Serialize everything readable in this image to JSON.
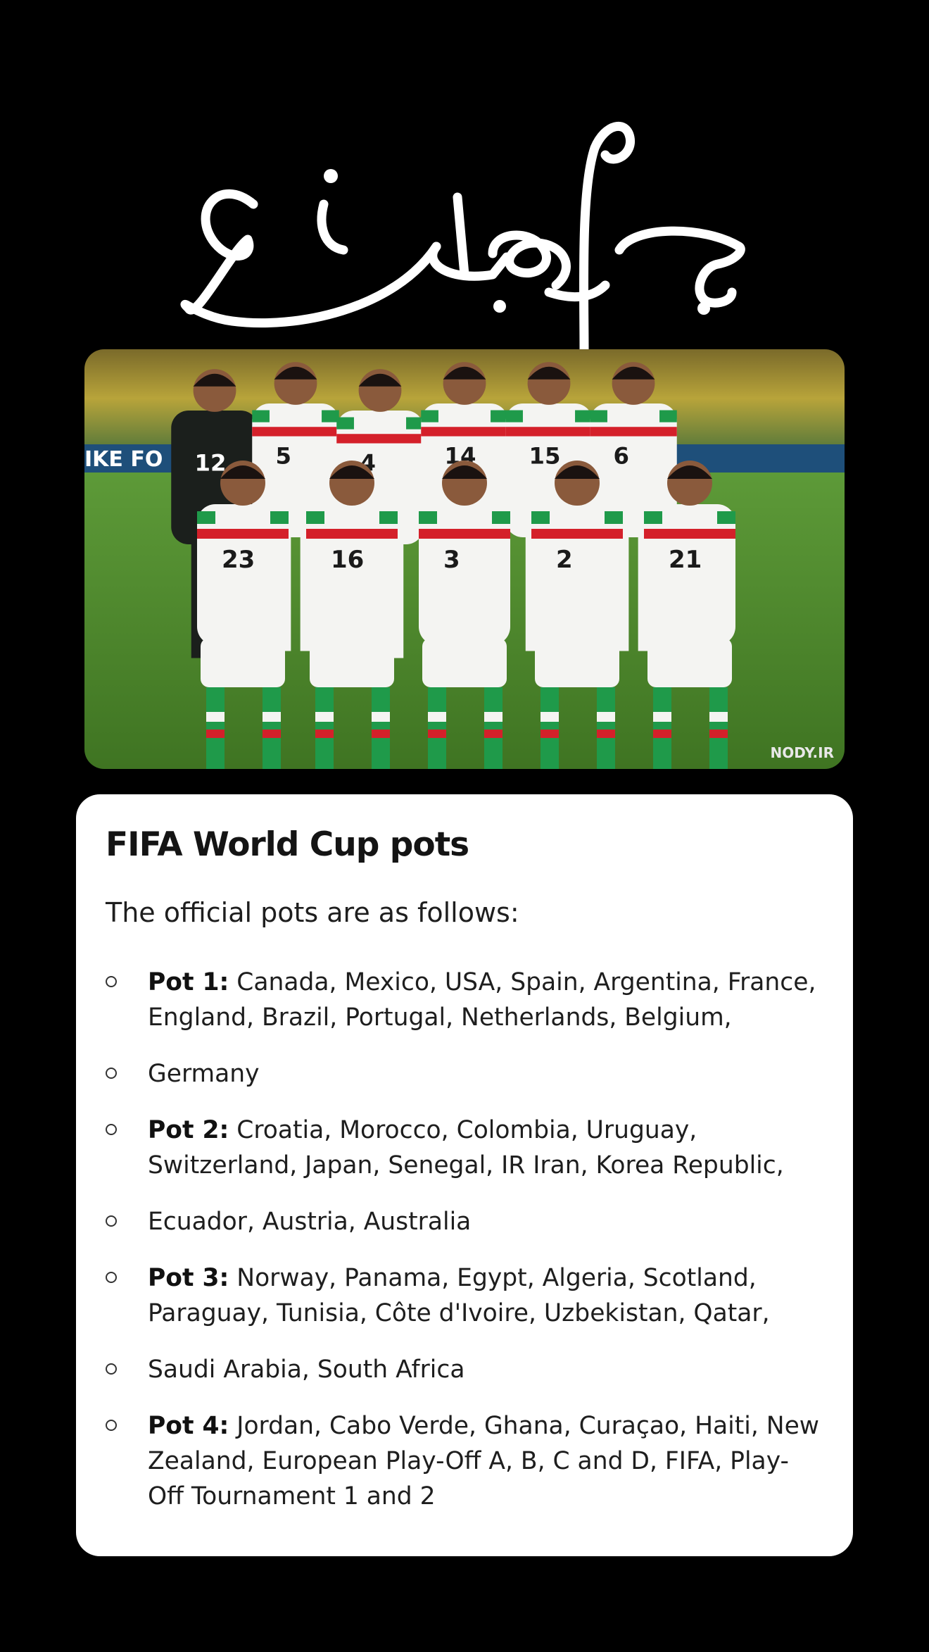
{
  "header": {
    "title_lettering": "جام جهانی"
  },
  "photo": {
    "watermark": "NODY.IR",
    "banner_text": "IKE FO",
    "jersey_numbers": [
      "12",
      "5",
      "4",
      "14",
      "15",
      "6",
      "23",
      "16",
      "3",
      "2",
      "21"
    ]
  },
  "card": {
    "title": "FIFA World Cup pots",
    "intro": "The official pots are as follows:",
    "items": [
      {
        "label": "Pot 1:",
        "text": " Canada, Mexico, USA, Spain, Argentina, France, England, Brazil, Portugal, Netherlands, Belgium,"
      },
      {
        "label": "",
        "text": "Germany"
      },
      {
        "label": "Pot 2:",
        "text": " Croatia, Morocco, Colombia, Uruguay, Switzerland, Japan, Senegal, IR Iran, Korea Republic,"
      },
      {
        "label": "",
        "text": "Ecuador, Austria, Australia"
      },
      {
        "label": "Pot 3:",
        "text": " Norway, Panama, Egypt, Algeria, Scotland, Paraguay, Tunisia, Côte d'Ivoire, Uzbekistan, Qatar,"
      },
      {
        "label": "",
        "text": "Saudi Arabia, South Africa"
      },
      {
        "label": "Pot 4:",
        "text": " Jordan, Cabo Verde, Ghana, Curaçao, Haiti, New Zealand, European Play-Off A, B, C and D, FIFA, Play-Off Tournament 1 and 2"
      }
    ]
  },
  "colors": {
    "background": "#000000",
    "card": "#ffffff",
    "title_lettering": "#ffffff",
    "jersey_white": "#f4f4f2",
    "jersey_red": "#d4202a",
    "jersey_green": "#1f9a4a",
    "goalkeeper": "#1b1f1c",
    "pitch": "#4f8a2e"
  }
}
